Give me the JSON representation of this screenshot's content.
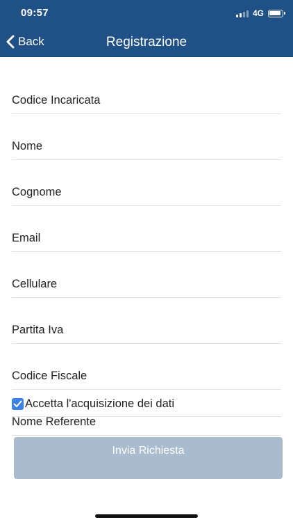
{
  "status_bar": {
    "time": "09:57",
    "network": "4G",
    "signal_icon": "signal-bars-icon",
    "battery_icon": "battery-icon"
  },
  "nav": {
    "back_label": "Back",
    "back_icon": "chevron-left-icon",
    "title": "Registrazione"
  },
  "form": {
    "fields": [
      {
        "name": "codice-incaricata",
        "placeholder": "Codice Incaricata"
      },
      {
        "name": "nome",
        "placeholder": "Nome"
      },
      {
        "name": "cognome",
        "placeholder": "Cognome"
      },
      {
        "name": "email",
        "placeholder": "Email"
      },
      {
        "name": "cellulare",
        "placeholder": "Cellulare"
      },
      {
        "name": "partita-iva",
        "placeholder": "Partita Iva"
      },
      {
        "name": "codice-fiscale",
        "placeholder": "Codice Fiscale"
      },
      {
        "name": "nome-referente",
        "placeholder": "Nome Referente"
      }
    ],
    "consent": {
      "label": "Accetta l'acquisizione dei dati",
      "checked": true,
      "checkbox_icon": "checkmark-icon"
    },
    "submit_label": "Invia Richiesta"
  },
  "colors": {
    "nav_background": "#1f5086",
    "checkbox_accent": "#3b82e6",
    "submit_background": "#a9bccd"
  }
}
